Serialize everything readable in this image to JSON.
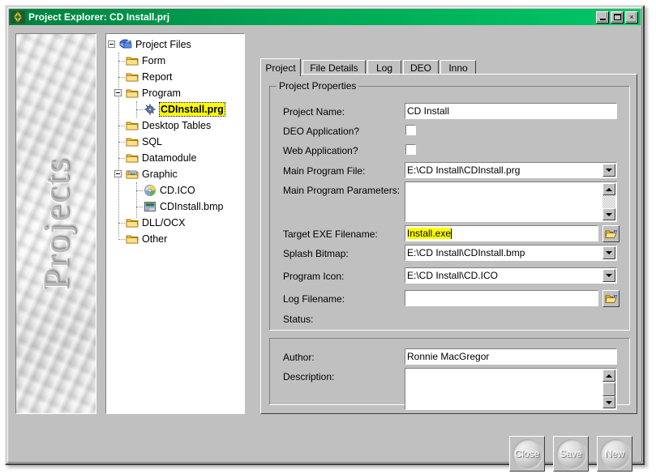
{
  "window": {
    "title": "Project Explorer: CD Install.prj",
    "icon": "compass-diamond-icon",
    "titlebar_color": "#00a352",
    "buttons": {
      "minimize": "minimize-icon",
      "maximize": "maximize-icon",
      "close": "×"
    }
  },
  "banner": {
    "text": "Projects"
  },
  "tree": {
    "nodes": [
      {
        "label": "Project Files",
        "icon": "project-files-icon",
        "depth": 0,
        "expander": "minus",
        "selected": false
      },
      {
        "label": "Form",
        "icon": "folder-icon",
        "depth": 1,
        "expander": "none",
        "selected": false
      },
      {
        "label": "Report",
        "icon": "folder-icon",
        "depth": 1,
        "expander": "none",
        "selected": false
      },
      {
        "label": "Program",
        "icon": "folder-icon",
        "depth": 1,
        "expander": "minus",
        "selected": false
      },
      {
        "label": "CDInstall.prg",
        "icon": "program-gear-icon",
        "depth": 2,
        "expander": "none",
        "selected": true
      },
      {
        "label": "Desktop Tables",
        "icon": "folder-icon",
        "depth": 1,
        "expander": "none",
        "selected": false
      },
      {
        "label": "SQL",
        "icon": "folder-icon",
        "depth": 1,
        "expander": "none",
        "selected": false
      },
      {
        "label": "Datamodule",
        "icon": "folder-icon",
        "depth": 1,
        "expander": "none",
        "selected": false
      },
      {
        "label": "Graphic",
        "icon": "graphic-folder-icon",
        "depth": 1,
        "expander": "minus",
        "selected": false
      },
      {
        "label": "CD.ICO",
        "icon": "cd-disc-icon",
        "depth": 2,
        "expander": "none",
        "selected": false
      },
      {
        "label": "CDInstall.bmp",
        "icon": "bitmap-icon",
        "depth": 2,
        "expander": "none",
        "selected": false
      },
      {
        "label": "DLL/OCX",
        "icon": "folder-icon",
        "depth": 1,
        "expander": "none",
        "selected": false
      },
      {
        "label": "Other",
        "icon": "folder-icon",
        "depth": 1,
        "expander": "none",
        "selected": false
      }
    ]
  },
  "tabs": [
    {
      "label": "Project",
      "active": true
    },
    {
      "label": "File Details",
      "active": false
    },
    {
      "label": "Log",
      "active": false
    },
    {
      "label": "DEO",
      "active": false
    },
    {
      "label": "Inno",
      "active": false
    }
  ],
  "project_properties": {
    "group_title": "Project Properties",
    "fields": {
      "project_name": {
        "label": "Project Name:",
        "value": "CD Install"
      },
      "deo_application": {
        "label": "DEO Application?",
        "checked": false
      },
      "web_application": {
        "label": "Web Application?",
        "checked": false
      },
      "main_program_file": {
        "label": "Main Program File:",
        "value": "E:\\CD Install\\CDInstall.prg"
      },
      "main_program_params": {
        "label": "Main Program Parameters:",
        "value": ""
      },
      "target_exe": {
        "label": "Target EXE Filename:",
        "value": "Install.exe",
        "highlighted": true
      },
      "splash_bitmap": {
        "label": "Splash Bitmap:",
        "value": "E:\\CD Install\\CDInstall.bmp"
      },
      "program_icon": {
        "label": "Program Icon:",
        "value": "E:\\CD Install\\CD.ICO"
      },
      "log_filename": {
        "label": "Log Filename:",
        "value": ""
      },
      "status": {
        "label": "Status:",
        "value": ""
      }
    }
  },
  "author_section": {
    "author": {
      "label": "Author:",
      "value": "Ronnie MacGregor"
    },
    "description": {
      "label": "Description:",
      "value": ""
    }
  },
  "footer_buttons": [
    {
      "label": "Close"
    },
    {
      "label": "Save"
    },
    {
      "label": "New"
    }
  ],
  "icons": {
    "browse": "open-folder-browse-icon",
    "dropdown": "chevron-down-icon",
    "scroll_up": "scroll-up-arrow-icon",
    "scroll_down": "scroll-down-arrow-icon"
  }
}
